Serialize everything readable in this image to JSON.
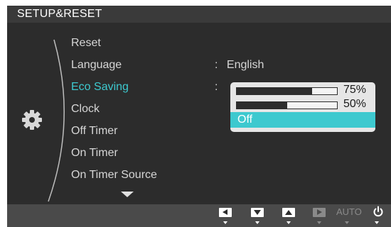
{
  "title": "SETUP&RESET",
  "menu": {
    "items": [
      {
        "label": "Reset"
      },
      {
        "label": "Language"
      },
      {
        "label": "Eco Saving"
      },
      {
        "label": "Clock"
      },
      {
        "label": "Off Timer"
      },
      {
        "label": "On Timer"
      },
      {
        "label": "On Timer Source"
      }
    ],
    "active_item": "Eco Saving",
    "more_indicator": "down-arrow-icon"
  },
  "values": {
    "language": {
      "separator": ":",
      "value": "English"
    },
    "eco_saving": {
      "separator": ":"
    }
  },
  "eco_popup": {
    "options": [
      {
        "label": "75%",
        "level": 0.75
      },
      {
        "label": "50%",
        "level": 0.5
      },
      {
        "label": "Off"
      }
    ],
    "selected": "Off"
  },
  "controls": {
    "buttons": [
      {
        "icon": "left-arrow-icon",
        "enabled": true
      },
      {
        "icon": "down-arrow-icon",
        "enabled": true
      },
      {
        "icon": "up-arrow-icon",
        "enabled": true
      },
      {
        "icon": "enter-icon",
        "enabled": false
      }
    ],
    "auto_label": "AUTO",
    "power_icon": "power-icon"
  },
  "colors": {
    "accent": "#3dc9cf",
    "panel": "#2c2c2c",
    "title_bar": "#3a3a3a",
    "bottom_bar": "#4a4a4a"
  }
}
